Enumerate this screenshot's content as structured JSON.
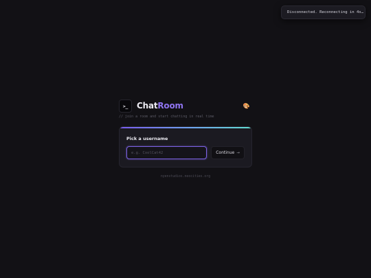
{
  "toast": {
    "message": "Disconnected. Reconnecting in 4s…"
  },
  "header": {
    "logo_glyph": ">_",
    "title_part1": "Chat",
    "title_part2": "Room",
    "theme_icon": "palette-icon"
  },
  "subtitle": "// join a room and start chatting in real time",
  "login_card": {
    "label": "Pick a username",
    "input_placeholder": "e.g. CoolCat42",
    "input_value": "",
    "continue_label": "Continue",
    "continue_icon": "arrow-right-icon"
  },
  "footer": {
    "text": "nyenstudios.neocities.org"
  },
  "colors": {
    "background": "#121115",
    "accent_purple": "#8f74f0",
    "accent_cyan": "#62e0d2"
  }
}
